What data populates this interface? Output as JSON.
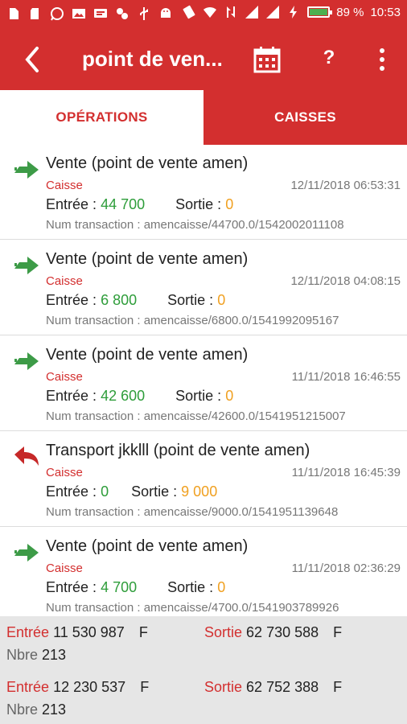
{
  "status_bar": {
    "battery_percent": "89 %",
    "battery_level": 0.89,
    "time": "10:53",
    "icons": [
      "sim-icon",
      "sd-icon",
      "whatsapp-icon",
      "image-icon",
      "message-icon",
      "app-icon",
      "usb-icon",
      "android-icon",
      "vibrate-icon",
      "wifi-icon",
      "data-icon",
      "signal-icon",
      "signal-icon",
      "charging-icon"
    ]
  },
  "app_bar": {
    "title": "point de ven...",
    "help_label": "?"
  },
  "tabs": [
    {
      "label": "OPÉRATIONS",
      "active": true
    },
    {
      "label": "CAISSES",
      "active": false
    }
  ],
  "operations": [
    {
      "icon": "arrow-right-icon",
      "name": "Vente (point de vente amen)",
      "category": "Caisse",
      "date": "12/11/2018 06:53:31",
      "entree_label": "Entrée :",
      "entree": "44 700",
      "sortie_label": "Sortie :",
      "sortie": "0",
      "transaction": "Num transaction : amencaisse/44700.0/1542002011108"
    },
    {
      "icon": "arrow-right-icon",
      "name": "Vente (point de vente amen)",
      "category": "Caisse",
      "date": "12/11/2018 04:08:15",
      "entree_label": "Entrée :",
      "entree": "6 800",
      "sortie_label": "Sortie :",
      "sortie": "0",
      "transaction": "Num transaction : amencaisse/6800.0/1541992095167"
    },
    {
      "icon": "arrow-right-icon",
      "name": "Vente (point de vente amen)",
      "category": "Caisse",
      "date": "11/11/2018 16:46:55",
      "entree_label": "Entrée :",
      "entree": "42 600",
      "sortie_label": "Sortie :",
      "sortie": "0",
      "transaction": "Num transaction : amencaisse/42600.0/1541951215007"
    },
    {
      "icon": "reply-arrow-icon",
      "name": "Transport jkklll (point de vente amen)",
      "category": "Caisse",
      "date": "11/11/2018 16:45:39",
      "entree_label": "Entrée :",
      "entree": "0",
      "sortie_label": "Sortie :",
      "sortie": "9 000",
      "transaction": "Num transaction : amencaisse/9000.0/1541951139648"
    },
    {
      "icon": "arrow-right-icon",
      "name": "Vente (point de vente amen)",
      "category": "Caisse",
      "date": "11/11/2018 02:36:29",
      "entree_label": "Entrée :",
      "entree": "4 700",
      "sortie_label": "Sortie :",
      "sortie": "0",
      "transaction": "Num transaction : amencaisse/4700.0/1541903789926"
    }
  ],
  "totals": [
    {
      "entree_label": "Entrée",
      "entree": "11 530 987",
      "entree_unit": "F",
      "sortie_label": "Sortie",
      "sortie": "62 730 588",
      "sortie_unit": "F",
      "nbre_label": "Nbre",
      "nbre": "213"
    },
    {
      "entree_label": "Entrée",
      "entree": "12 230 537",
      "entree_unit": "F",
      "sortie_label": "Sortie",
      "sortie": "62 752 388",
      "sortie_unit": "F",
      "nbre_label": "Nbre",
      "nbre": "213"
    }
  ],
  "colors": {
    "primary": "#d32f2f",
    "entree": "#2e9d3a",
    "sortie": "#f0a020",
    "arrow_in": "#3d9b47",
    "arrow_out": "#c62828"
  }
}
